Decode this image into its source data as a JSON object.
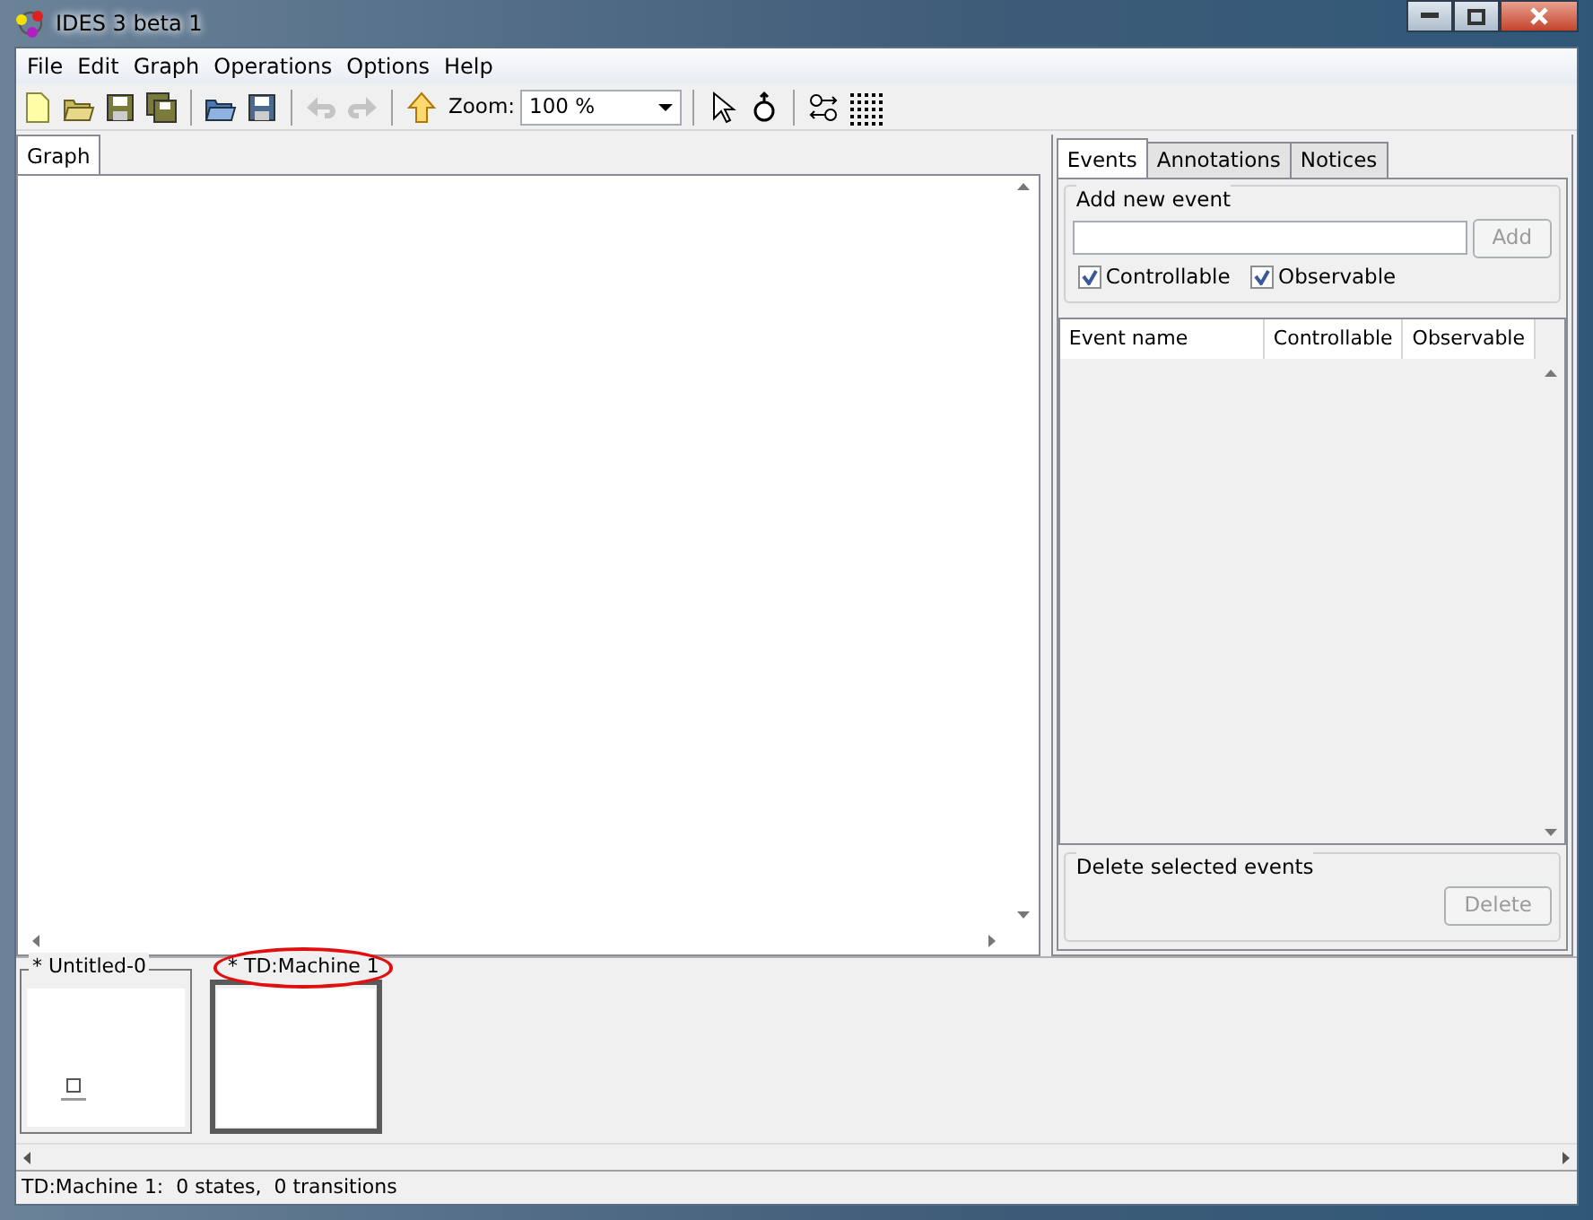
{
  "window": {
    "title": "IDES 3 beta 1"
  },
  "menu": [
    "File",
    "Edit",
    "Graph",
    "Operations",
    "Options",
    "Help"
  ],
  "toolbar": [
    {
      "kind": "new",
      "disabled": false
    },
    {
      "kind": "open",
      "disabled": false
    },
    {
      "kind": "save",
      "disabled": false
    },
    {
      "kind": "saveall",
      "disabled": false
    },
    {
      "kind": "separator"
    },
    {
      "kind": "openws",
      "disabled": false
    },
    {
      "kind": "savews",
      "disabled": false
    },
    {
      "kind": "separator"
    },
    {
      "kind": "undo",
      "disabled": true
    },
    {
      "kind": "redo",
      "disabled": true
    },
    {
      "kind": "separator"
    },
    {
      "kind": "up",
      "disabled": false
    },
    {
      "kind": "zoom",
      "label": "Zoom:",
      "value": "100 %"
    },
    {
      "kind": "separator"
    },
    {
      "kind": "select",
      "disabled": false
    },
    {
      "kind": "state",
      "disabled": false
    },
    {
      "kind": "separator"
    },
    {
      "kind": "layout",
      "disabled": false
    },
    {
      "kind": "grid",
      "disabled": false
    }
  ],
  "graph_tabs": [
    {
      "label": "Graph",
      "selected": true
    }
  ],
  "side_tabs": [
    {
      "label": "Events",
      "selected": true
    },
    {
      "label": "Annotations",
      "selected": false
    },
    {
      "label": "Notices",
      "selected": false
    }
  ],
  "add_event": {
    "legend": "Add new event",
    "button": "Add",
    "button_disabled": true,
    "checkboxes": [
      {
        "label": "Controllable",
        "checked": true
      },
      {
        "label": "Observable",
        "checked": true
      }
    ]
  },
  "events_table": {
    "columns": [
      "Event name",
      "Controllable",
      "Observable"
    ]
  },
  "delete_group": {
    "legend": "Delete selected events",
    "button": "Delete",
    "button_disabled": true
  },
  "thumbnails": [
    {
      "title": "* Untitled-0",
      "selected": false,
      "circled": false,
      "has_state": true
    },
    {
      "title": "* TD:Machine 1",
      "selected": true,
      "circled": true,
      "has_state": false
    }
  ],
  "status_bar": "TD:Machine 1:  0 states,  0 transitions"
}
